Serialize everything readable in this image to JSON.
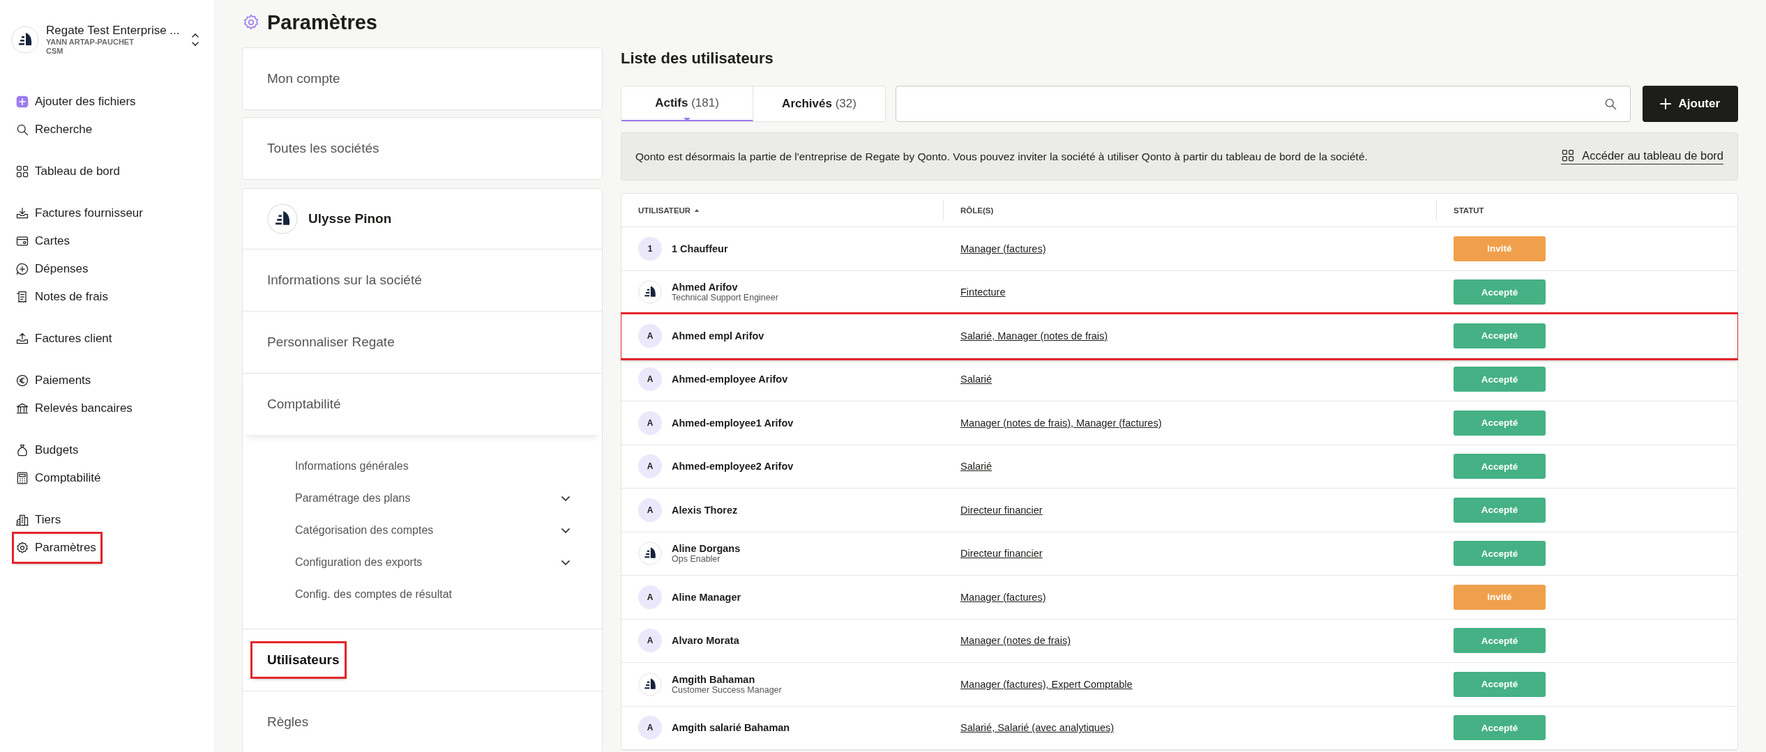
{
  "sidebar": {
    "company": "Regate Test Enterprise ...",
    "user": "YANN ARTAP-PAUCHET",
    "role": "CSM",
    "groups": [
      [
        {
          "label": "Ajouter des fichiers",
          "highlighted": false
        },
        {
          "label": "Recherche",
          "highlighted": false
        }
      ],
      [
        {
          "label": "Tableau de bord",
          "highlighted": false
        }
      ],
      [
        {
          "label": "Factures fournisseur",
          "highlighted": false
        },
        {
          "label": "Cartes",
          "highlighted": false
        },
        {
          "label": "Dépenses",
          "highlighted": false
        },
        {
          "label": "Notes de frais",
          "highlighted": false
        }
      ],
      [
        {
          "label": "Factures client",
          "highlighted": false
        }
      ],
      [
        {
          "label": "Paiements",
          "highlighted": false
        },
        {
          "label": "Relevés bancaires",
          "highlighted": false
        }
      ],
      [
        {
          "label": "Budgets",
          "highlighted": false
        },
        {
          "label": "Comptabilité",
          "highlighted": false
        }
      ],
      [
        {
          "label": "Tiers",
          "highlighted": false
        },
        {
          "label": "Paramètres",
          "highlighted": true
        }
      ]
    ]
  },
  "settings": {
    "title": "Paramètres",
    "cards": [
      {
        "label": "Mon compte"
      },
      {
        "label": "Toutes les sociétés"
      }
    ],
    "company": {
      "name": "Ulysse Pinon",
      "items": [
        {
          "label": "Informations sur la société",
          "selected": false,
          "highlighted": false
        },
        {
          "label": "Personnaliser Regate",
          "selected": false,
          "highlighted": false
        },
        {
          "label": "Comptabilité",
          "selected": false,
          "highlighted": false,
          "expanded": true,
          "children": [
            {
              "label": "Informations générales",
              "expandable": false
            },
            {
              "label": "Paramétrage des plans",
              "expandable": true
            },
            {
              "label": "Catégorisation des comptes",
              "expandable": true
            },
            {
              "label": "Configuration des exports",
              "expandable": true
            },
            {
              "label": "Config. des comptes de résultat",
              "expandable": false
            }
          ]
        },
        {
          "label": "Utilisateurs",
          "selected": true,
          "highlighted": true
        },
        {
          "label": "Règles",
          "selected": false,
          "highlighted": false
        }
      ]
    }
  },
  "users": {
    "title": "Liste des utilisateurs",
    "tabs": [
      {
        "label": "Actifs",
        "count": "(181)",
        "selected": true
      },
      {
        "label": "Archivés",
        "count": "(32)",
        "selected": false
      }
    ],
    "add_button": "Ajouter",
    "banner": {
      "text": "Qonto est désormais la partie de l'entreprise de Regate by Qonto. Vous pouvez inviter la société à utiliser Qonto à partir du tableau de bord de la société.",
      "link": "Accéder au tableau de bord"
    },
    "columns": [
      {
        "label": "UTILISATEUR",
        "sorted": true
      },
      {
        "label": "RÔLE(S)"
      },
      {
        "label": "STATUT"
      }
    ],
    "rows": [
      {
        "name": "1 Chauffeur",
        "avatar": {
          "kind": "initial",
          "text": "1"
        },
        "roles": "Manager (factures)",
        "status": {
          "label": "Invité",
          "kind": "invited"
        },
        "highlighted": false
      },
      {
        "name": "Ahmed Arifov",
        "subtitle": "Technical Support Engineer",
        "avatar": {
          "kind": "logo"
        },
        "roles": "Fintecture",
        "status": {
          "label": "Accepté",
          "kind": "accepted"
        },
        "highlighted": false
      },
      {
        "name": "Ahmed empl Arifov",
        "avatar": {
          "kind": "initial",
          "text": "A"
        },
        "roles": "Salarié, Manager (notes de frais)",
        "status": {
          "label": "Accepté",
          "kind": "accepted"
        },
        "highlighted": true
      },
      {
        "name": "Ahmed-employee Arifov",
        "avatar": {
          "kind": "initial",
          "text": "A"
        },
        "roles": "Salarié",
        "status": {
          "label": "Accepté",
          "kind": "accepted"
        },
        "highlighted": false
      },
      {
        "name": "Ahmed-employee1 Arifov",
        "avatar": {
          "kind": "initial",
          "text": "A"
        },
        "roles": "Manager (notes de frais), Manager (factures)",
        "status": {
          "label": "Accepté",
          "kind": "accepted"
        },
        "highlighted": false
      },
      {
        "name": "Ahmed-employee2 Arifov",
        "avatar": {
          "kind": "initial",
          "text": "A"
        },
        "roles": "Salarié",
        "status": {
          "label": "Accepté",
          "kind": "accepted"
        },
        "highlighted": false
      },
      {
        "name": "Alexis Thorez",
        "avatar": {
          "kind": "initial",
          "text": "A"
        },
        "roles": "Directeur financier",
        "status": {
          "label": "Accepté",
          "kind": "accepted"
        },
        "highlighted": false
      },
      {
        "name": "Aline Dorgans",
        "subtitle": "Ops Enabler",
        "avatar": {
          "kind": "logo"
        },
        "roles": "Directeur financier",
        "status": {
          "label": "Accepté",
          "kind": "accepted"
        },
        "highlighted": false
      },
      {
        "name": "Aline Manager",
        "avatar": {
          "kind": "initial",
          "text": "A"
        },
        "roles": "Manager (factures)",
        "status": {
          "label": "Invité",
          "kind": "invited"
        },
        "highlighted": false
      },
      {
        "name": "Alvaro Morata",
        "avatar": {
          "kind": "initial",
          "text": "A"
        },
        "roles": "Manager (notes de frais)",
        "status": {
          "label": "Accepté",
          "kind": "accepted"
        },
        "highlighted": false
      },
      {
        "name": "Amgith Bahaman",
        "subtitle": "Customer Success Manager",
        "avatar": {
          "kind": "logo"
        },
        "roles": "Manager (factures), Expert Comptable",
        "status": {
          "label": "Accepté",
          "kind": "accepted"
        },
        "highlighted": false
      },
      {
        "name": "Amgith salarié Bahaman",
        "avatar": {
          "kind": "initial",
          "text": "A"
        },
        "roles": "Salarié, Salarié (avec analytiques)",
        "status": {
          "label": "Accepté",
          "kind": "accepted"
        },
        "highlighted": false
      }
    ]
  }
}
